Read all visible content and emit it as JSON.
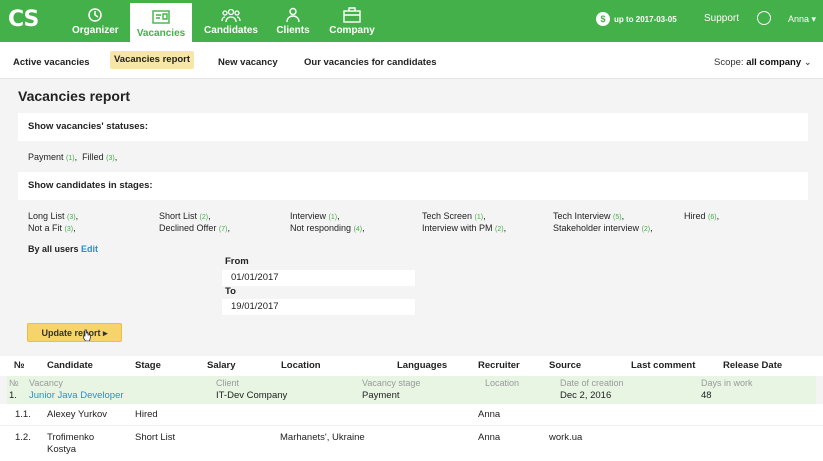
{
  "app": {
    "logo": "CS"
  },
  "nav": {
    "items": [
      {
        "label": "Organizer"
      },
      {
        "label": "Vacancies"
      },
      {
        "label": "Candidates"
      },
      {
        "label": "Clients"
      },
      {
        "label": "Company"
      }
    ],
    "date_info": "up to 2017-03-05",
    "support": "Support",
    "user": "Anna ▾",
    "colors": {
      "brand": "#43b049",
      "accent": "#f7d36b",
      "link": "#2a8fd0"
    }
  },
  "subnav": {
    "items": [
      "Active vacancies",
      "Vacancies report",
      "New vacancy",
      "Our vacancies for candidates"
    ],
    "scope_label": "Scope:",
    "scope_value": "all company",
    "scope_arrow": "⌄"
  },
  "report": {
    "title": "Vacancies report",
    "statuses_header": "Show vacancies' statuses:",
    "statuses": [
      {
        "label": "Payment",
        "count": "(1)",
        "sep": ","
      },
      {
        "label": "Filled",
        "count": "(3)",
        "sep": ","
      }
    ],
    "stages_header": "Show candidates in stages:",
    "stages": [
      {
        "label": "Long List",
        "count": "(3)",
        "sep": ","
      },
      {
        "label": "Short List",
        "count": "(2)",
        "sep": ","
      },
      {
        "label": "Interview",
        "count": "(1)",
        "sep": ","
      },
      {
        "label": "Tech Screen",
        "count": "(1)",
        "sep": ","
      },
      {
        "label": "Tech Interview",
        "count": "(5)",
        "sep": ","
      },
      {
        "label": "Hired",
        "count": "(6)",
        "sep": ","
      },
      {
        "label": "Not a Fit",
        "count": "(3)",
        "sep": ","
      },
      {
        "label": "Declined Offer",
        "count": "(7)",
        "sep": ","
      },
      {
        "label": "Not responding",
        "count": "(4)",
        "sep": ","
      },
      {
        "label": "Interview with PM",
        "count": "(2)",
        "sep": ","
      },
      {
        "label": "Stakeholder interview",
        "count": "(2)",
        "sep": ","
      }
    ],
    "by_users": "By all users",
    "edit": "Edit",
    "from_label": "From",
    "from_value": "01/01/2017",
    "to_label": "To",
    "to_value": "19/01/2017",
    "update_button": "Update report ▸"
  },
  "table": {
    "headers": [
      "№",
      "Candidate",
      "Stage",
      "Salary",
      "Location",
      "Languages",
      "Recruiter",
      "Source",
      "Last comment",
      "Release Date"
    ],
    "group": {
      "sublabels": [
        "№",
        "Vacancy",
        "Client",
        "Vacancy stage",
        "Location",
        "Date of creation",
        "Days in work"
      ],
      "values": {
        "num": "1.",
        "vacancy": "Junior Java Developer",
        "client": "IT-Dev Company",
        "stage": "Payment",
        "location": "",
        "created": "Dec 2, 2016",
        "days": "48"
      }
    },
    "rows": [
      {
        "num": "1.1.",
        "candidate": "Alexey Yurkov",
        "stage": "Hired",
        "salary": "",
        "location": "",
        "languages": "",
        "recruiter": "Anna",
        "source": "",
        "comment": "",
        "release": ""
      },
      {
        "num": "1.2.",
        "candidate": "Trofimenko",
        "candidate2": "Kostya",
        "stage": "Short List",
        "salary": "",
        "location": "Marhanets', Ukraine",
        "languages": "",
        "recruiter": "Anna",
        "source": "work.ua",
        "comment": "",
        "release": ""
      }
    ]
  }
}
